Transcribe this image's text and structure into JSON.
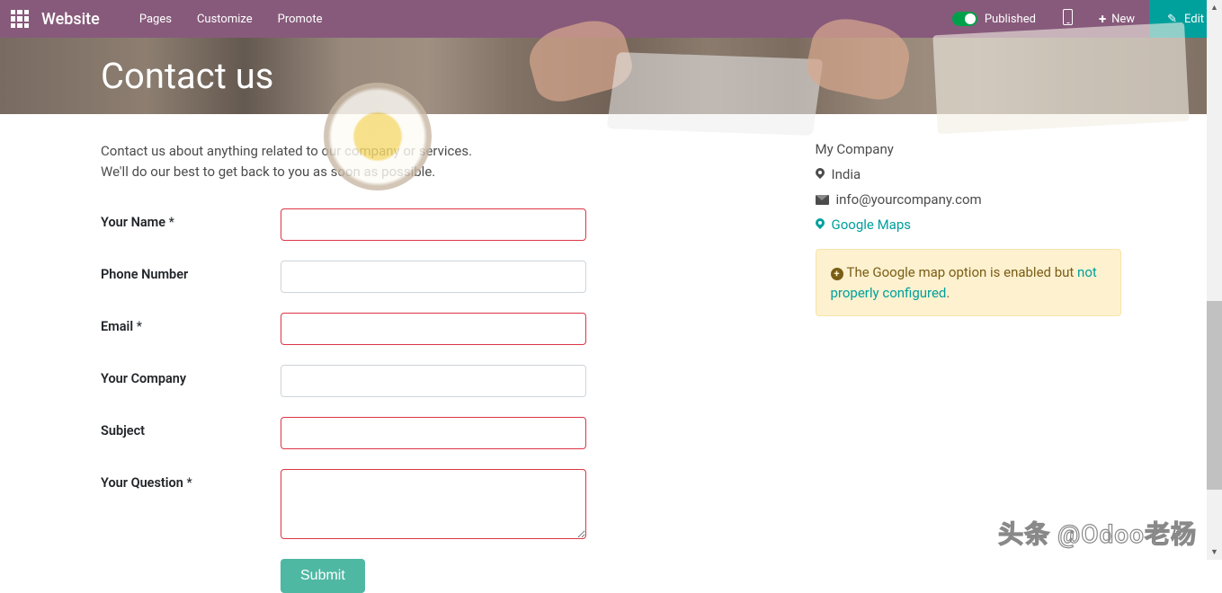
{
  "topbar": {
    "brand": "Website",
    "menu": {
      "pages": "Pages",
      "customize": "Customize",
      "promote": "Promote"
    },
    "published": "Published",
    "new_label": "New",
    "edit_label": "Edit"
  },
  "banner": {
    "title": "Contact us"
  },
  "intro": {
    "line1": "Contact us about anything related to our company or services.",
    "line2": "We'll do our best to get back to you as soon as possible."
  },
  "form": {
    "your_name": "Your Name",
    "phone": "Phone Number",
    "email": "Email",
    "company": "Your Company",
    "subject": "Subject",
    "question": "Your Question",
    "submit": "Submit"
  },
  "company": {
    "name": "My Company",
    "country": "India",
    "email": "info@yourcompany.com",
    "maps": "Google Maps"
  },
  "alert": {
    "part1": "The Google map option is enabled but ",
    "link": "not properly configured",
    "part2": "."
  },
  "watermark": "头条 @Odoo老杨"
}
